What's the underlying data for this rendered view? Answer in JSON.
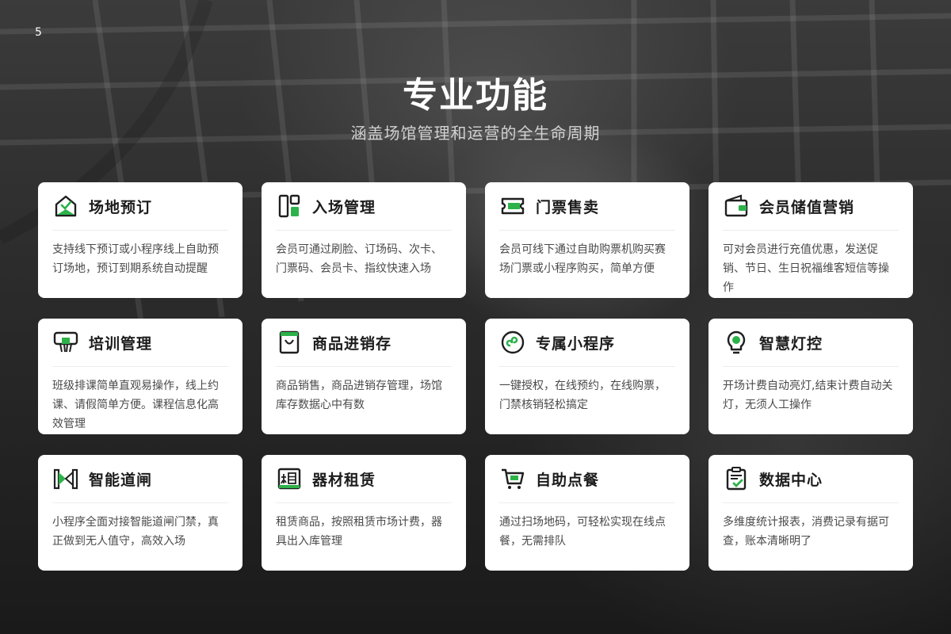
{
  "page_number": "5",
  "title": "专业功能",
  "subtitle": "涵盖场馆管理和运营的全生命周期",
  "colors": {
    "accent": "#2db24a",
    "icon_stroke": "#1f1f1f",
    "card_bg": "#ffffff"
  },
  "cards": [
    {
      "icon": "venue-booking-icon",
      "title": "场地预订",
      "desc": "支持线下预订或小程序线上自助预订场地，预订到期系统自动提醒"
    },
    {
      "icon": "entry-management-icon",
      "title": "入场管理",
      "desc": "会员可通过刷脸、订场码、次卡、门票码、会员卡、指纹快速入场"
    },
    {
      "icon": "ticket-icon",
      "title": "门票售卖",
      "desc": "会员可线下通过自助购票机购买赛场门票或小程序购买，简单方便"
    },
    {
      "icon": "wallet-icon",
      "title": "会员储值营销",
      "desc": "可对会员进行充值优惠，发送促销、节日、生日祝福维客短信等操作"
    },
    {
      "icon": "training-board-icon",
      "title": "培训管理",
      "desc": "班级排课简单直观易操作，线上约课、请假简单方便。课程信息化高效管理"
    },
    {
      "icon": "shopping-bag-icon",
      "title": "商品进销存",
      "desc": "商品销售，商品进销存管理，场馆库存数据心中有数"
    },
    {
      "icon": "mini-program-icon",
      "title": "专属小程序",
      "desc": "一键授权，在线预约，在线购票，门禁核销轻松搞定"
    },
    {
      "icon": "light-bulb-icon",
      "title": "智慧灯控",
      "desc": "开场计费自动亮灯,结束计费自动关灯，无须人工操作"
    },
    {
      "icon": "turnstile-gate-icon",
      "title": "智能道闸",
      "desc": "小程序全面对接智能道闸门禁，真正做到无人值守，高效入场"
    },
    {
      "icon": "rent-icon",
      "title": "器材租赁",
      "desc": "租赁商品，按照租赁市场计费，器具出入库管理"
    },
    {
      "icon": "shopping-cart-icon",
      "title": "自助点餐",
      "desc": "通过扫场地码，可轻松实现在线点餐，无需排队"
    },
    {
      "icon": "clipboard-check-icon",
      "title": "数据中心",
      "desc": "多维度统计报表，消费记录有据可查，账本清晰明了"
    }
  ]
}
